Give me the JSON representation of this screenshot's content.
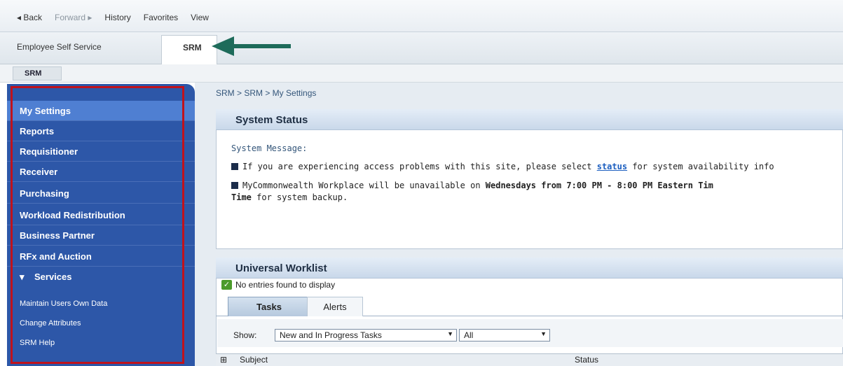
{
  "topnav": {
    "back": "◂ Back",
    "forward": "Forward ▸",
    "history": "History",
    "favorites": "Favorites",
    "view": "View"
  },
  "tabs": {
    "ess": "Employee Self Service",
    "srm": "SRM"
  },
  "subtab": "SRM",
  "sidebar": {
    "items": [
      "My Settings",
      "Reports",
      "Requisitioner",
      "Receiver",
      "Purchasing",
      "Workload Redistribution",
      "Business Partner",
      "RFx and Auction"
    ],
    "services": "Services",
    "links": [
      "Maintain Users Own Data",
      "Change Attributes",
      "SRM Help"
    ]
  },
  "breadcrumb": "SRM  >  SRM  >  My Settings",
  "system_status": {
    "title": "System Status",
    "label": "System Message:",
    "line1_a": "If you are experiencing access problems with this site, please select ",
    "line1_link": "status",
    "line1_b": " for system availability info",
    "line2_a": "MyCommonwealth Workplace will be unavailable on ",
    "line2_bold": "Wednesdays from 7:00 PM - 8:00 PM Eastern Tim",
    "line3_bold": "Time",
    "line3_rest": " for system backup."
  },
  "worklist": {
    "title": "Universal Worklist",
    "no_entries": "No entries found to display",
    "tab_tasks": "Tasks",
    "tab_alerts": "Alerts",
    "show_label": "Show:",
    "show_value": "New and In Progress Tasks",
    "all_value": "All",
    "col_subject": "Subject",
    "col_status": "Status"
  },
  "colors": {
    "sidebar": "#2d57a8",
    "highlight": "#c0121c",
    "arrow": "#1e6b5a"
  }
}
